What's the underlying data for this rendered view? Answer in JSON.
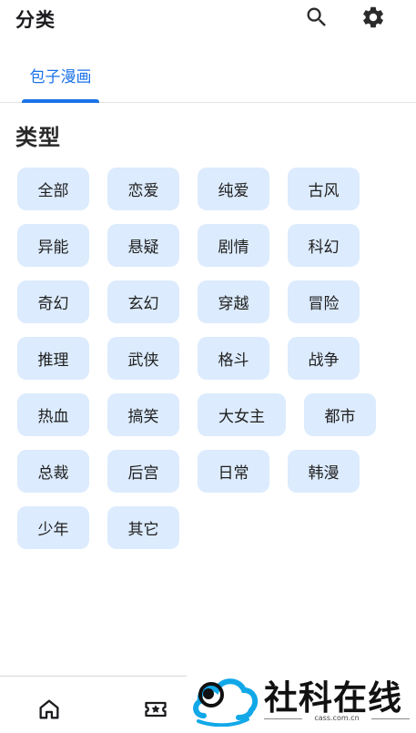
{
  "header": {
    "title": "分类",
    "search_icon": "search-icon",
    "settings_icon": "gear-icon"
  },
  "tabs": [
    {
      "label": "包子漫画",
      "active": true
    }
  ],
  "section": {
    "title": "类型"
  },
  "genres": {
    "rows": [
      [
        "全部",
        "恋爱",
        "纯爱",
        "古风"
      ],
      [
        "异能",
        "悬疑",
        "剧情",
        "科幻"
      ],
      [
        "奇幻",
        "玄幻",
        "穿越",
        "冒险"
      ],
      [
        "推理",
        "武侠",
        "格斗",
        "战争"
      ],
      [
        "热血",
        "搞笑",
        "大女主",
        "都市"
      ],
      [
        "总裁",
        "后宫",
        "日常",
        "韩漫"
      ],
      [
        "少年",
        "其它"
      ]
    ]
  },
  "bottom_nav": {
    "items": [
      {
        "icon": "home-icon"
      },
      {
        "icon": "ticket-star-icon"
      }
    ]
  },
  "watermark": {
    "text": "社科在线",
    "sub": "cass.com.cn"
  },
  "colors": {
    "accent": "#1a73e8",
    "chip_bg": "#dcebfd",
    "watermark_cloud": "#12a8e8"
  }
}
